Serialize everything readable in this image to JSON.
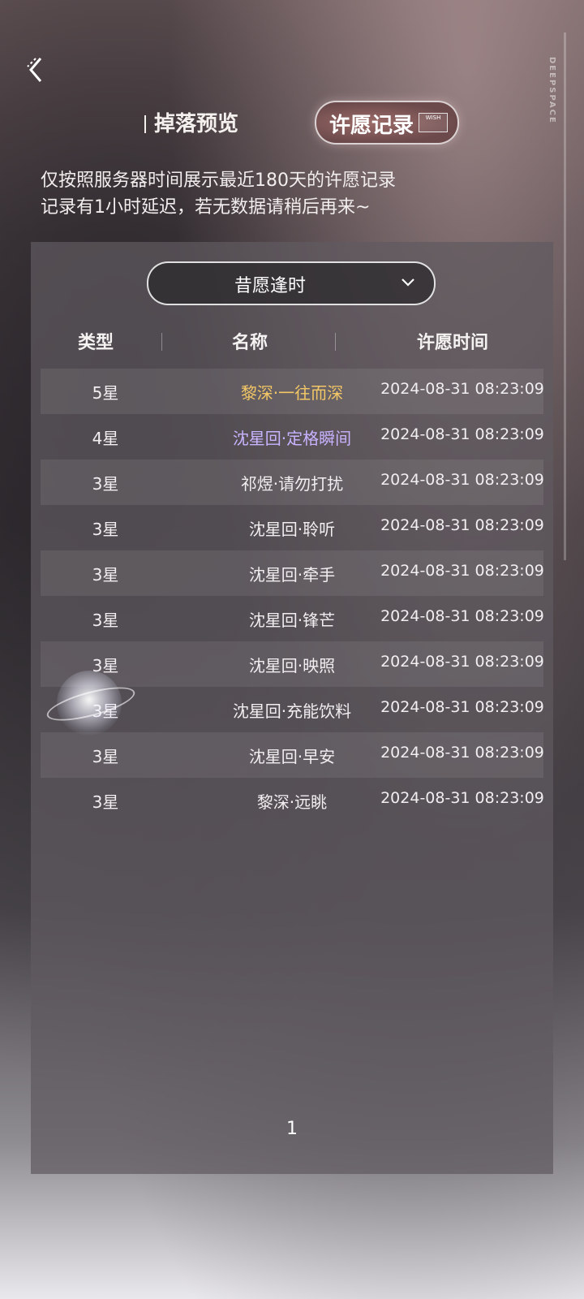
{
  "header": {
    "tab_drop_preview": "掉落预览",
    "tab_wish_record": "许愿记录",
    "tab_wish_tag": "WISH",
    "side_text": "DEEPSPACE"
  },
  "notice": {
    "line1": "仅按照服务器时间展示最近180天的许愿记录",
    "line2": "记录有1小时延迟，若无数据请稍后再来~"
  },
  "pool_select": {
    "value": "昔愿逢时"
  },
  "table": {
    "columns": [
      "类型",
      "名称",
      "许愿时间"
    ],
    "rows": [
      {
        "type": "5星",
        "name": "黎深·一往而深",
        "time": "2024-08-31 08:23:09",
        "rarity": "gold"
      },
      {
        "type": "4星",
        "name": "沈星回·定格瞬间",
        "time": "2024-08-31 08:23:09",
        "rarity": "purple"
      },
      {
        "type": "3星",
        "name": "祁煜·请勿打扰",
        "time": "2024-08-31 08:23:09",
        "rarity": "normal"
      },
      {
        "type": "3星",
        "name": "沈星回·聆听",
        "time": "2024-08-31 08:23:09",
        "rarity": "normal"
      },
      {
        "type": "3星",
        "name": "沈星回·牵手",
        "time": "2024-08-31 08:23:09",
        "rarity": "normal"
      },
      {
        "type": "3星",
        "name": "沈星回·锋芒",
        "time": "2024-08-31 08:23:09",
        "rarity": "normal"
      },
      {
        "type": "3星",
        "name": "沈星回·映照",
        "time": "2024-08-31 08:23:09",
        "rarity": "normal"
      },
      {
        "type": "3星",
        "name": "沈星回·充能饮料",
        "time": "2024-08-31 08:23:09",
        "rarity": "normal"
      },
      {
        "type": "3星",
        "name": "沈星回·早安",
        "time": "2024-08-31 08:23:09",
        "rarity": "normal"
      },
      {
        "type": "3星",
        "name": "黎深·远眺",
        "time": "2024-08-31 08:23:09",
        "rarity": "normal"
      }
    ]
  },
  "pagination": {
    "current": "1"
  },
  "colors": {
    "gold": "#f3c766",
    "purple": "#c8b3ff"
  }
}
